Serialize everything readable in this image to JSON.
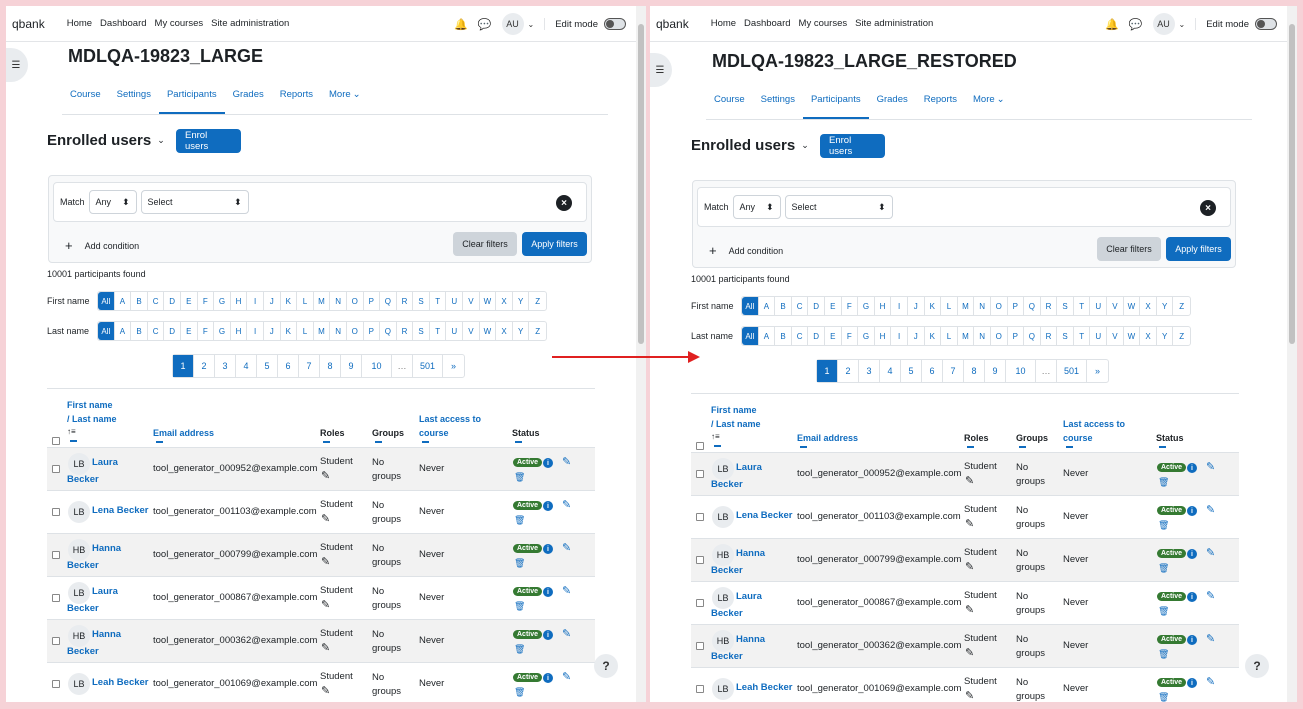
{
  "nav": {
    "brand": "qbank",
    "links": [
      "Home",
      "Dashboard",
      "My courses",
      "Site administration"
    ],
    "avatar": "AU",
    "edit_mode": "Edit mode"
  },
  "tabs": [
    "Course",
    "Settings",
    "Participants",
    "Grades",
    "Reports",
    "More"
  ],
  "left": {
    "title": "MDLQA-19823_LARGE"
  },
  "right": {
    "title": "MDLQA-19823_LARGE_RESTORED"
  },
  "enrol": {
    "heading": "Enrolled users",
    "enrol_button": "Enrol users"
  },
  "filter": {
    "match_label": "Match",
    "match_value": "Any",
    "select_value": "Select",
    "add_condition": "Add condition",
    "clear": "Clear filters",
    "apply": "Apply filters"
  },
  "participants_found": "10001 participants found",
  "initials": {
    "first_label": "First name",
    "last_label": "Last name",
    "letters": [
      "All",
      "A",
      "B",
      "C",
      "D",
      "E",
      "F",
      "G",
      "H",
      "I",
      "J",
      "K",
      "L",
      "M",
      "N",
      "O",
      "P",
      "Q",
      "R",
      "S",
      "T",
      "U",
      "V",
      "W",
      "X",
      "Y",
      "Z"
    ]
  },
  "pagination": [
    "1",
    "2",
    "3",
    "4",
    "5",
    "6",
    "7",
    "8",
    "9",
    "10",
    "…",
    "501",
    "»"
  ],
  "table": {
    "headers": {
      "name1": "First name",
      "name2": "/ Last name",
      "sort_icon": "↑≡",
      "email": "Email address",
      "roles": "Roles",
      "groups": "Groups",
      "access1": "Last access to",
      "access2": "course",
      "status": "Status"
    },
    "rows": [
      {
        "initials": "LB",
        "first": "Laura",
        "last": "Becker",
        "email": "tool_generator_000952@example.com",
        "role": "Student",
        "groups": "No groups",
        "access": "Never",
        "status": "Active"
      },
      {
        "initials": "LB",
        "first": "Lena Becker",
        "last": "",
        "email": "tool_generator_001103@example.com",
        "role": "Student",
        "groups": "No groups",
        "access": "Never",
        "status": "Active"
      },
      {
        "initials": "HB",
        "first": "Hanna",
        "last": "Becker",
        "email": "tool_generator_000799@example.com",
        "role": "Student",
        "groups": "No groups",
        "access": "Never",
        "status": "Active"
      },
      {
        "initials": "LB",
        "first": "Laura",
        "last": "Becker",
        "email": "tool_generator_000867@example.com",
        "role": "Student",
        "groups": "No groups",
        "access": "Never",
        "status": "Active"
      },
      {
        "initials": "HB",
        "first": "Hanna",
        "last": "Becker",
        "email": "tool_generator_000362@example.com",
        "role": "Student",
        "groups": "No groups",
        "access": "Never",
        "status": "Active"
      },
      {
        "initials": "LB",
        "first": "Leah Becker",
        "last": "",
        "email": "tool_generator_001069@example.com",
        "role": "Student",
        "groups": "No groups",
        "access": "Never",
        "status": "Active"
      }
    ]
  },
  "help": "?",
  "colors": {
    "primary": "#0f6cbf",
    "active_badge": "#357a32",
    "arrow": "#e02020",
    "frame": "#f6d2d7"
  }
}
